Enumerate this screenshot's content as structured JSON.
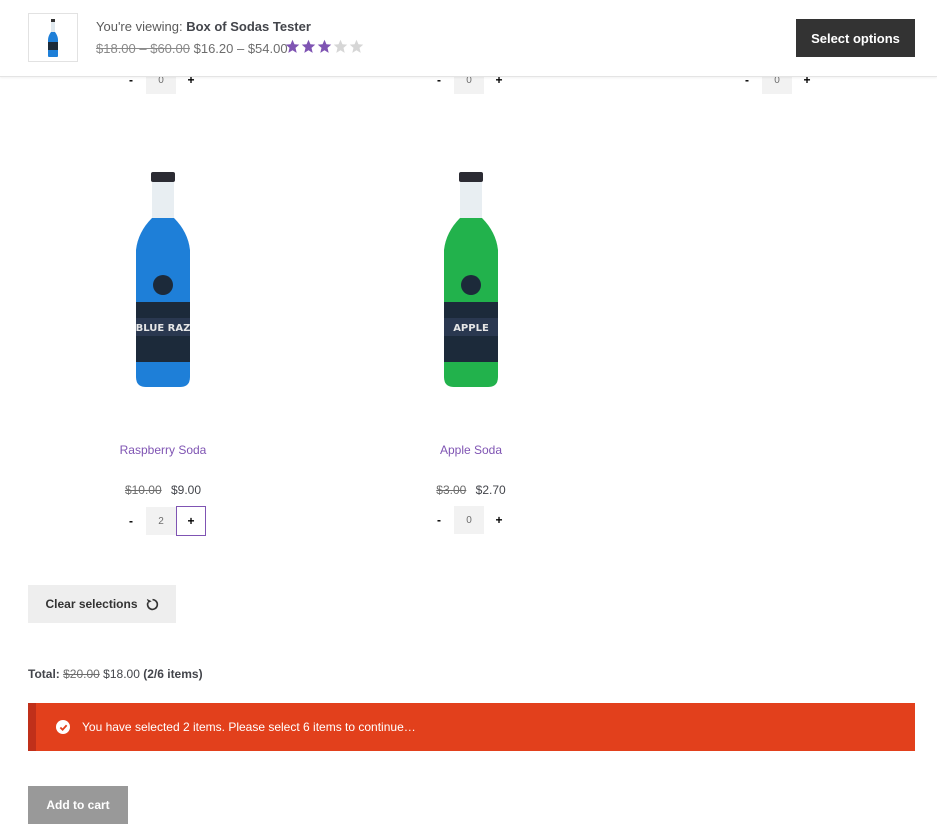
{
  "sticky": {
    "viewing_prefix": "You're viewing:",
    "product_name": "Box of Sodas Tester",
    "old_price": "$18.00 – $60.00",
    "new_price": "$16.20 – $54.00",
    "rating": 3,
    "rating_max": 5,
    "select_options_label": "Select options"
  },
  "top_qty_rows": [
    {
      "minus": "-",
      "value": "0",
      "plus": "+"
    },
    {
      "minus": "-",
      "value": "0",
      "plus": "+"
    },
    {
      "minus": "-",
      "value": "0",
      "plus": "+"
    }
  ],
  "products": [
    {
      "title": "Raspberry Soda",
      "old_price": "$10.00",
      "price": "$9.00",
      "label_text": "BLUE RAZ",
      "liquid_color": "#1e7fd8",
      "qty": {
        "minus": "-",
        "value": "2",
        "plus": "+"
      }
    },
    {
      "title": "Apple Soda",
      "old_price": "$3.00",
      "price": "$2.70",
      "label_text": "APPLE",
      "liquid_color": "#22b24c",
      "qty": {
        "minus": "-",
        "value": "0",
        "plus": "+"
      }
    }
  ],
  "clear_selections_label": "Clear selections",
  "total": {
    "label": "Total:",
    "old": "$20.00",
    "new": "$18.00",
    "items": "(2/6 items)"
  },
  "notice_text": "You have selected 2 items. Please select 6 items to continue…",
  "add_to_cart_label": "Add to cart",
  "colors": {
    "accent": "#7f54b3",
    "notice_bg": "#e2401c",
    "dark_button": "#333333",
    "disabled_button": "#999999"
  }
}
